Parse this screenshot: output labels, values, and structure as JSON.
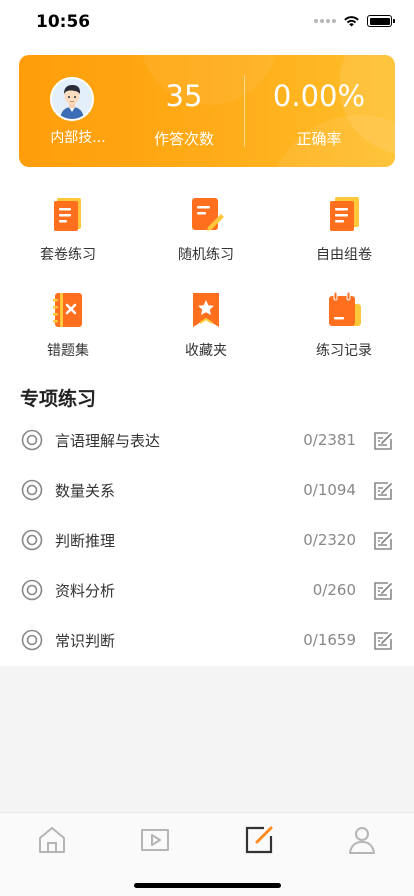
{
  "status_bar": {
    "time": "10:56"
  },
  "stats": {
    "user_name": "内部技...",
    "answer_count": "35",
    "answer_count_label": "作答次数",
    "accuracy": "0.00%",
    "accuracy_label": "正确率"
  },
  "features": [
    {
      "label": "套卷练习",
      "icon": "scroll-paper-icon"
    },
    {
      "label": "随机练习",
      "icon": "document-pencil-icon"
    },
    {
      "label": "自由组卷",
      "icon": "stacked-papers-icon"
    },
    {
      "label": "错题集",
      "icon": "wrong-notebook-icon"
    },
    {
      "label": "收藏夹",
      "icon": "star-bookmark-icon"
    },
    {
      "label": "练习记录",
      "icon": "record-notebook-icon"
    }
  ],
  "special_practice": {
    "title": "专项练习",
    "items": [
      {
        "label": "言语理解与表达",
        "count": "0/2381"
      },
      {
        "label": "数量关系",
        "count": "0/1094"
      },
      {
        "label": "判断推理",
        "count": "0/2320"
      },
      {
        "label": "资料分析",
        "count": "0/260"
      },
      {
        "label": "常识判断",
        "count": "0/1659"
      }
    ]
  },
  "tab_bar": {
    "tabs": [
      {
        "icon": "home-icon",
        "active": false
      },
      {
        "icon": "video-play-icon",
        "active": false
      },
      {
        "icon": "edit-square-icon",
        "active": true
      },
      {
        "icon": "profile-icon",
        "active": false
      }
    ]
  },
  "colors": {
    "card_gradient_start": "#ff9d0a",
    "card_gradient_end": "#ffbf2a",
    "icon_orange": "#ff7a21",
    "icon_yellow": "#ffc83a",
    "active_tab": "#ff8a1f",
    "inactive_tab": "#b5b5b5"
  }
}
